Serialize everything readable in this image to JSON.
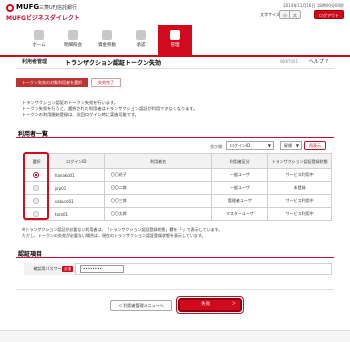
{
  "header": {
    "brand": "MUFG",
    "bank": "三菱UFJ信託銀行",
    "service": "MUFGビジネスダイレクト",
    "datetime": "2014年11月16日 18時00分00秒",
    "font_size_label": "文字サイズ",
    "font_small": "小",
    "font_large": "大",
    "logout": "ログアウト"
  },
  "nav": {
    "items": [
      {
        "label": "ホーム"
      },
      {
        "label": "明細照会"
      },
      {
        "label": "資金移動"
      },
      {
        "label": "承認"
      },
      {
        "label": "管理"
      }
    ],
    "active_index": 4
  },
  "page": {
    "category": "利用者管理",
    "title": "トランザクション認証トークン失効",
    "screen_id": "BKKT001",
    "help": "ヘルプ"
  },
  "steps": [
    "トークン失効の対象利用者を選択",
    "失効完了"
  ],
  "intro": [
    "トランザクション認証のトークン失効を行います。",
    "トークン失効を行うと、選択された利用者はトランザクション認証が利用できなくなります。",
    "トークンの利用開始登録は、次回ログイン時に実施可能です。"
  ],
  "users_section": {
    "title": "利用者一覧",
    "sort_label": "並び順：",
    "sort_value": "ログインID",
    "order_value": "昇順",
    "reorder_button": "再表示",
    "columns": [
      "選択",
      "ログインID",
      "利用者名",
      "利用者区分",
      "トランザクション認証登録状態"
    ],
    "rows": [
      {
        "selected": true,
        "login_id": "hanako01",
        "name": "〇〇花子",
        "type": "一般ユーザ",
        "status": "サービス利用中"
      },
      {
        "selected": false,
        "login_id": "jiro01",
        "name": "〇〇二郎",
        "type": "一般ユーザ",
        "status": "未登録"
      },
      {
        "selected": false,
        "login_id": "saburo01",
        "name": "〇〇三郎",
        "type": "管理者ユーザ",
        "status": "サービス利用中"
      },
      {
        "selected": false,
        "login_id": "taro01",
        "name": "〇〇太郎",
        "type": "マスターユーザ",
        "status": "サービス利用中"
      }
    ],
    "note": [
      "※トランザクション認証が必要ない利用者は、「トランザクション認証登録状態」欄を「-」で表示しています。",
      "ただし、トークンの失効が必要ない場合は、現在のトランザクション認証登録状態を表示しています。"
    ]
  },
  "auth_section": {
    "title": "認証項目",
    "field_label": "確認用パスワード",
    "required": "必須",
    "password_mask": "••••••••"
  },
  "buttons": {
    "back": "利用者管理メニューへ",
    "execute": "失効"
  },
  "colors": {
    "accent": "#d10a1e",
    "header_bg": "#ffffff"
  }
}
